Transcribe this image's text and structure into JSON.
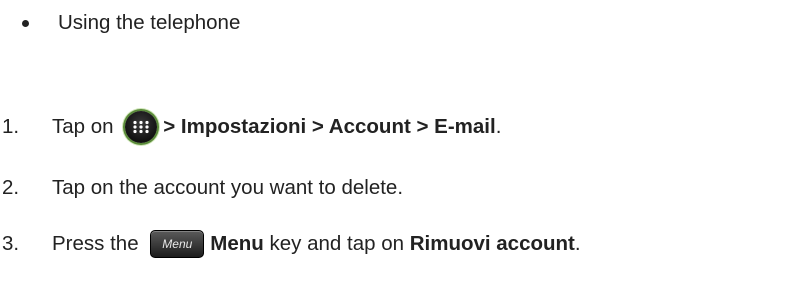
{
  "bullet": {
    "text": "Using the telephone"
  },
  "steps": [
    {
      "number": "1.",
      "prefix": "Tap on ",
      "icon": "apps-grid-icon",
      "bold_path": "> Impostazioni > Account > E-mail",
      "suffix": "."
    },
    {
      "number": "2.",
      "text": "Tap on the account you want to delete."
    },
    {
      "number": "3.",
      "prefix": "Press the ",
      "key_label": "Menu",
      "bold_key": "Menu",
      "middle": " key and tap on ",
      "bold_action": "Rimuovi account",
      "suffix": "."
    }
  ]
}
